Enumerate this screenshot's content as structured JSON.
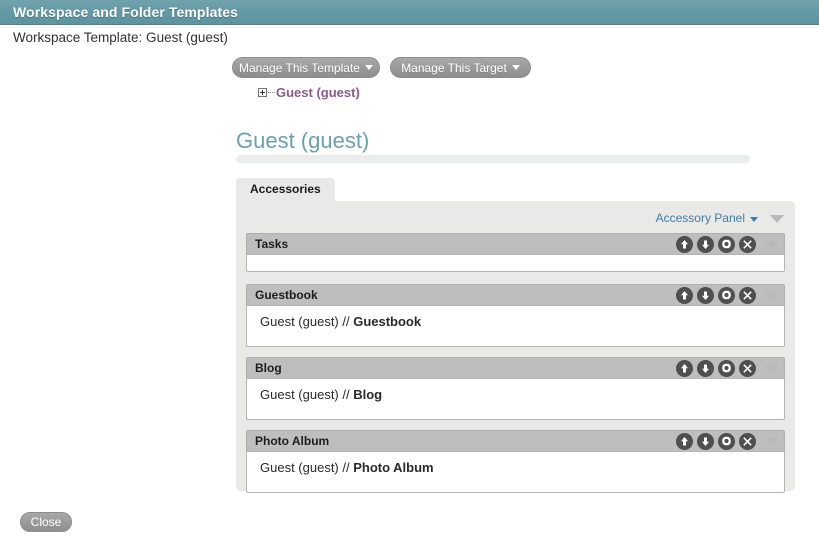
{
  "window": {
    "title": "Workspace and Folder Templates",
    "accent_teal": "#5e94a0"
  },
  "subtitle": "Workspace Template: Guest (guest)",
  "toolbar": {
    "manage_template_label": "Manage This Template",
    "manage_target_label": "Manage This Target"
  },
  "tree": {
    "node_label": "Guest (guest)",
    "node_color": "#8b5a8f",
    "expander": "plus-box"
  },
  "page": {
    "heading": "Guest (guest)",
    "heading_color": "#6aa0b3"
  },
  "tabs": [
    {
      "label": "Accessories",
      "active": true
    }
  ],
  "panel": {
    "accessory_panel_link": "Accessory Panel",
    "accessory_panel_link_color": "#3d7dab"
  },
  "sections": [
    {
      "id": "tasks",
      "title": "Tasks",
      "body_prefix": "",
      "body_bold": "",
      "empty": true
    },
    {
      "id": "guestbook",
      "title": "Guestbook",
      "body_prefix": "Guest (guest) // ",
      "body_bold": "Guestbook",
      "empty": false
    },
    {
      "id": "blog",
      "title": "Blog",
      "body_prefix": "Guest (guest) // ",
      "body_bold": "Blog",
      "empty": false
    },
    {
      "id": "photo-album",
      "title": "Photo Album",
      "body_prefix": "Guest (guest) // ",
      "body_bold": "Photo Album",
      "empty": false
    }
  ],
  "section_tools": {
    "move_up": "move-up-icon",
    "move_down": "move-down-icon",
    "settings": "gear-icon",
    "remove": "close-icon",
    "collapse": "collapse-triangle-icon"
  },
  "footer": {
    "close_label": "Close"
  }
}
